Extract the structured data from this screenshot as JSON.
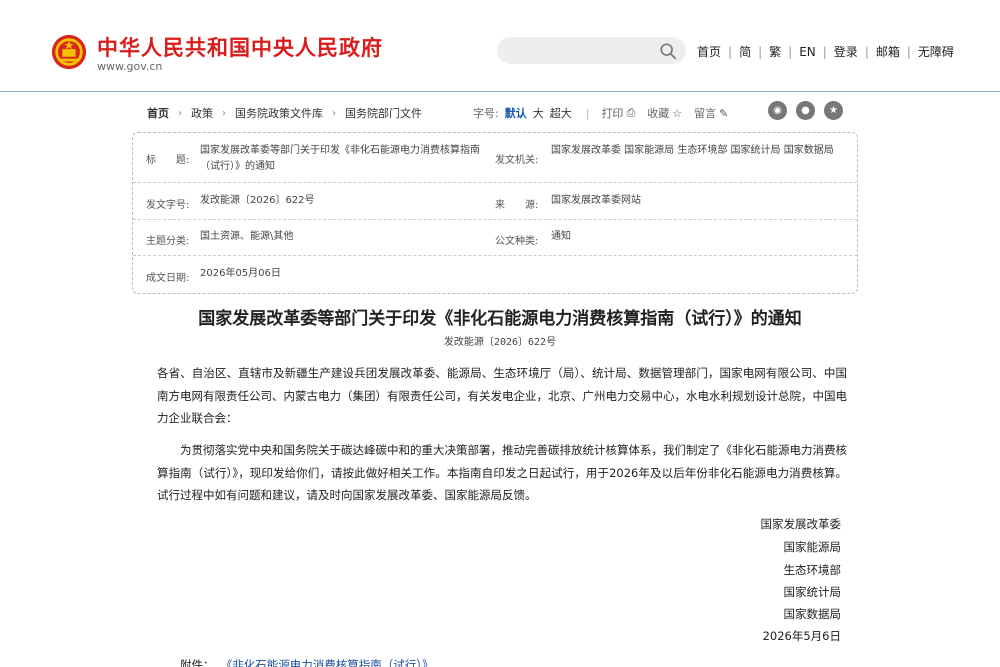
{
  "header": {
    "site_name": "中华人民共和国中央人民政府",
    "site_url": "www.gov.cn",
    "search_placeholder": "",
    "nav": [
      "首页",
      "简",
      "繁",
      "EN",
      "登录",
      "邮箱",
      "无障碍"
    ]
  },
  "breadcrumb": {
    "items": [
      "首页",
      "政策",
      "国务院政策文件库",
      "国务院部门文件"
    ]
  },
  "toolbar": {
    "font_label": "字号:",
    "font_default": "默认",
    "font_large": "大",
    "font_xlarge": "超大",
    "print": "打印",
    "favorite": "收藏",
    "comment": "留言"
  },
  "info": {
    "title_label": "标　　题:",
    "title_value": "国家发展改革委等部门关于印发《非化石能源电力消费核算指南（试行）》的通知",
    "issuer_label": "发文机关:",
    "issuer_value": "国家发展改革委  国家能源局  生态环境部  国家统计局  国家数据局",
    "docno_label": "发文字号:",
    "docno_value": "发改能源〔2026〕622号",
    "source_label": "来　　源:",
    "source_value": "国家发展改革委网站",
    "topic_label": "主题分类:",
    "topic_value": "国土资源、能源\\其他",
    "type_label": "公文种类:",
    "type_value": "通知",
    "date_label": "成文日期:",
    "date_value": "2026年05月06日"
  },
  "document": {
    "title": "国家发展改革委等部门关于印发《非化石能源电力消费核算指南（试行）》的通知",
    "number": "发改能源〔2026〕622号",
    "addressees": "各省、自治区、直辖市及新疆生产建设兵团发展改革委、能源局、生态环境厅（局）、统计局、数据管理部门，国家电网有限公司、中国南方电网有限责任公司、内蒙古电力（集团）有限责任公司，有关发电企业，北京、广州电力交易中心，水电水利规划设计总院，中国电力企业联合会：",
    "body": "为贯彻落实党中央和国务院关于碳达峰碳中和的重大决策部署，推动完善碳排放统计核算体系，我们制定了《非化石能源电力消费核算指南（试行）》，现印发给你们，请按此做好相关工作。本指南自印发之日起试行，用于2026年及以后年份非化石能源电力消费核算。试行过程中如有问题和建议，请及时向国家发展改革委、国家能源局反馈。",
    "signatories": [
      "国家发展改革委",
      "国家能源局",
      "生态环境部",
      "国家统计局",
      "国家数据局"
    ],
    "sign_date": "2026年5月6日",
    "attachment_label": "附件：",
    "attachment_link": "《非化石能源电力消费核算指南（试行）》"
  },
  "colors": {
    "brand_red": "#d91d1d",
    "link_blue": "#1a5cb3",
    "header_border": "#8aa9c9"
  },
  "icons": [
    "national-emblem-icon",
    "search-icon",
    "print-icon",
    "favorite-icon",
    "comment-icon",
    "weibo-icon",
    "wechat-icon",
    "star-icon"
  ]
}
